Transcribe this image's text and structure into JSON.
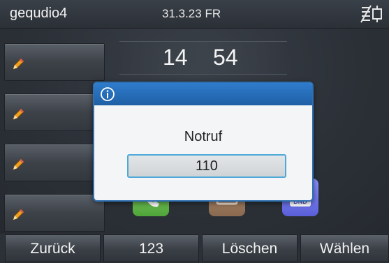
{
  "statusbar": {
    "account_name": "gequdio4",
    "date": "31.3.23 FR",
    "network_icon": "network-disconnected-icon"
  },
  "clock": {
    "hours": "14",
    "minutes": "54"
  },
  "linekeys": [
    {
      "icon": "pencil-icon",
      "label": ""
    },
    {
      "icon": "pencil-icon",
      "label": ""
    },
    {
      "icon": "pencil-icon",
      "label": ""
    },
    {
      "icon": "pencil-icon",
      "label": ""
    }
  ],
  "apps": [
    {
      "name": "call",
      "icon": "phone-icon"
    },
    {
      "name": "directory",
      "icon": "directory-icon"
    },
    {
      "name": "dnd",
      "icon": "dnd-icon",
      "text": "DND"
    }
  ],
  "dialog": {
    "icon": "info-icon",
    "title": "Notruf",
    "value": "110"
  },
  "softkeys": [
    "Zurück",
    "123",
    "Löschen",
    "Wählen"
  ],
  "colors": {
    "dialog_header": "#2f7ccc",
    "field_border": "#4ea9d8",
    "background": "#2c3138"
  }
}
